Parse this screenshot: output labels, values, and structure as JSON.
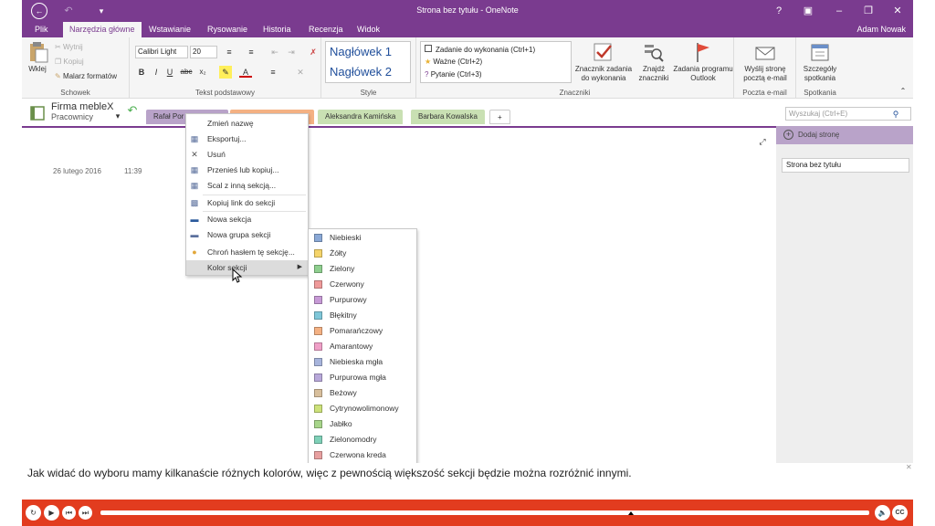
{
  "window": {
    "title": "Strona bez tytułu - OneNote"
  },
  "ribbon_tabs": [
    "Plik",
    "Narzędzia główne",
    "Wstawianie",
    "Rysowanie",
    "Historia",
    "Recenzja",
    "Widok"
  ],
  "user": "Adam Nowak",
  "clipboard": {
    "paste": "Wklej",
    "cut": "Wytnij",
    "copy": "Kopiuj",
    "format_painter": "Malarz formatów",
    "label": "Schowek"
  },
  "text": {
    "font": "Calibri Light",
    "size": "20",
    "label": "Tekst podstawowy",
    "bold": "B",
    "italic": "I",
    "underline": "U",
    "strike": "abc",
    "sub": "x₂"
  },
  "styles": {
    "h1": "Nagłówek 1",
    "h2": "Nagłówek 2",
    "label": "Style"
  },
  "tags": {
    "items": [
      "Zadanie do wykonania (Ctrl+1)",
      "Ważne (Ctrl+2)",
      "Pytanie (Ctrl+3)"
    ],
    "todo_tag": "Znacznik zadania do wykonania",
    "find_tags": "Znajdź znaczniki",
    "outlook_tasks": "Zadania programu Outlook",
    "label": "Znaczniki"
  },
  "email": {
    "send": "Wyślij stronę pocztą e-mail",
    "label": "Poczta e-mail"
  },
  "meetings": {
    "details": "Szczegóły spotkania",
    "label": "Spotkania"
  },
  "notebook": {
    "name": "Firma mebleX",
    "sub": "Pracownicy"
  },
  "sections": [
    "Rafał Por",
    "Aleksandra Kamińska",
    "Barbara Kowalska",
    "+"
  ],
  "search": {
    "placeholder": "Wyszukaj (Ctrl+E)"
  },
  "pages": {
    "add": "Dodaj stronę",
    "items": [
      "Strona bez tytułu"
    ]
  },
  "page": {
    "date": "26 lutego 2016",
    "time": "11:39"
  },
  "context_menu": [
    "Zmień nazwę",
    "Eksportuj...",
    "Usuń",
    "Przenieś lub kopiuj...",
    "Scal z inną sekcją...",
    "Kopiuj link do sekcji",
    "Nowa sekcja",
    "Nowa grupa sekcji",
    "Chroń hasłem tę sekcję...",
    "Kolor sekcji"
  ],
  "colors": [
    {
      "name": "Niebieski",
      "hex": "#8aa8d6"
    },
    {
      "name": "Żółty",
      "hex": "#f5d46a"
    },
    {
      "name": "Zielony",
      "hex": "#8fcf8f"
    },
    {
      "name": "Czerwony",
      "hex": "#ef9a9a"
    },
    {
      "name": "Purpurowy",
      "hex": "#c79ad6"
    },
    {
      "name": "Błękitny",
      "hex": "#7fc7d9"
    },
    {
      "name": "Pomarańczowy",
      "hex": "#f4b183"
    },
    {
      "name": "Amarantowy",
      "hex": "#f0a0c8"
    },
    {
      "name": "Niebieska mgła",
      "hex": "#a7b4dc"
    },
    {
      "name": "Purpurowa mgła",
      "hex": "#b8a8da"
    },
    {
      "name": "Beżowy",
      "hex": "#d8bf9c"
    },
    {
      "name": "Cytrynowolimonowy",
      "hex": "#cde27a"
    },
    {
      "name": "Jabłko",
      "hex": "#a7d58a"
    },
    {
      "name": "Zielonomodry",
      "hex": "#7fd1b8"
    },
    {
      "name": "Czerwona kreda",
      "hex": "#e8a0a0"
    }
  ],
  "caption": "Jak widać do wyboru mamy kilkanaście różnych kolorów, więc z pewnością większość sekcji będzie można rozróżnić innymi.",
  "accent": "#7a3b8f",
  "player_color": "#e23c1f"
}
